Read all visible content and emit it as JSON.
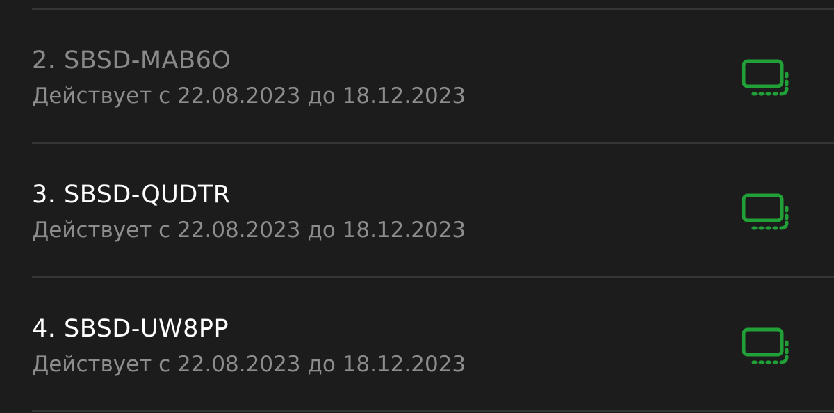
{
  "colors": {
    "background": "#1c1c1c",
    "divider": "#353535",
    "primary_text": "#ffffff",
    "dim_text": "#8a8a8a",
    "secondary_text": "#8d8d8d",
    "accent": "#21a038"
  },
  "items": [
    {
      "title": "2. SBSD-MAB6O",
      "validity": "Действует с 22.08.2023 до 18.12.2023",
      "icon": "multi-device-icon",
      "dimmed": true
    },
    {
      "title": "3. SBSD-QUDTR",
      "validity": "Действует с 22.08.2023 до 18.12.2023",
      "icon": "multi-device-icon",
      "dimmed": false
    },
    {
      "title": "4. SBSD-UW8PP",
      "validity": "Действует с 22.08.2023 до 18.12.2023",
      "icon": "multi-device-icon",
      "dimmed": false
    }
  ]
}
